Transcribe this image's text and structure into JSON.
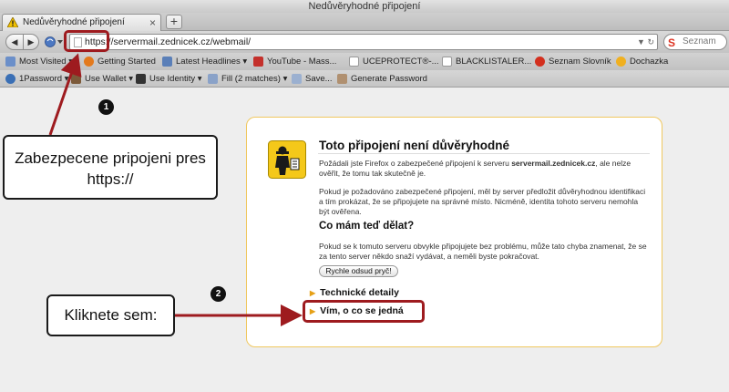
{
  "window": {
    "title": "Nedůvěryhodné připojení"
  },
  "tabs": [
    {
      "label": "Nedůvěryhodné připojení"
    }
  ],
  "tab_close": "×",
  "new_tab": "+",
  "nav": {
    "back": "◀",
    "forward": "▶",
    "url": "https://servermail.zednicek.cz/webmail/",
    "url_controls": "▼ ↻",
    "search_placeholder": "Seznam",
    "search_logo": "S"
  },
  "bookmarks": [
    {
      "label": "Most Visited ▾"
    },
    {
      "label": "Getting Started"
    },
    {
      "label": "Latest Headlines ▾"
    },
    {
      "label": "YouTube - Mass..."
    },
    {
      "label": "UCEPROTECT®-..."
    },
    {
      "label": "BLACKLISTALER..."
    },
    {
      "label": "Seznam Slovník"
    },
    {
      "label": "Dochazka"
    }
  ],
  "onepassword": [
    {
      "label": "1Password ▾"
    },
    {
      "label": "Use Wallet ▾"
    },
    {
      "label": "Use Identity ▾"
    },
    {
      "label": "Fill (2 matches) ▾"
    },
    {
      "label": "Save..."
    },
    {
      "label": "Generate Password"
    }
  ],
  "error_page": {
    "title": "Toto připojení není důvěryhodné",
    "para1_prefix": "Požádali jste Firefox o zabezpečené připojení k serveru ",
    "para1_server": "servermail.zednicek.cz",
    "para1_suffix": ", ale nelze ověřit, že tomu tak skutečně je.",
    "para2": "Pokud je požadováno zabezpečené připojení, měl by server předložit důvěryhodnou identifikaci a tím prokázat, že se připojujete na správné místo. Nicméně, identita tohoto serveru nemohla být ověřena.",
    "heading2": "Co mám teď dělat?",
    "para3": "Pokud se k tomuto serveru obvykle připojujete bez problému, může tato chyba znamenat, že se za tento server někdo snaží vydávat, a neměli byste pokračovat.",
    "button": "Rychle odsud pryč!",
    "expander1": "Technické detaily",
    "expander2": "Vím, o co se jedná",
    "expander_marker": "▶"
  },
  "annotations": {
    "callout1": "Zabezpecene pripojeni pres https://",
    "callout2": "Kliknete sem:",
    "badge1": "1",
    "badge2": "2",
    "color": "#9e1b1f"
  }
}
